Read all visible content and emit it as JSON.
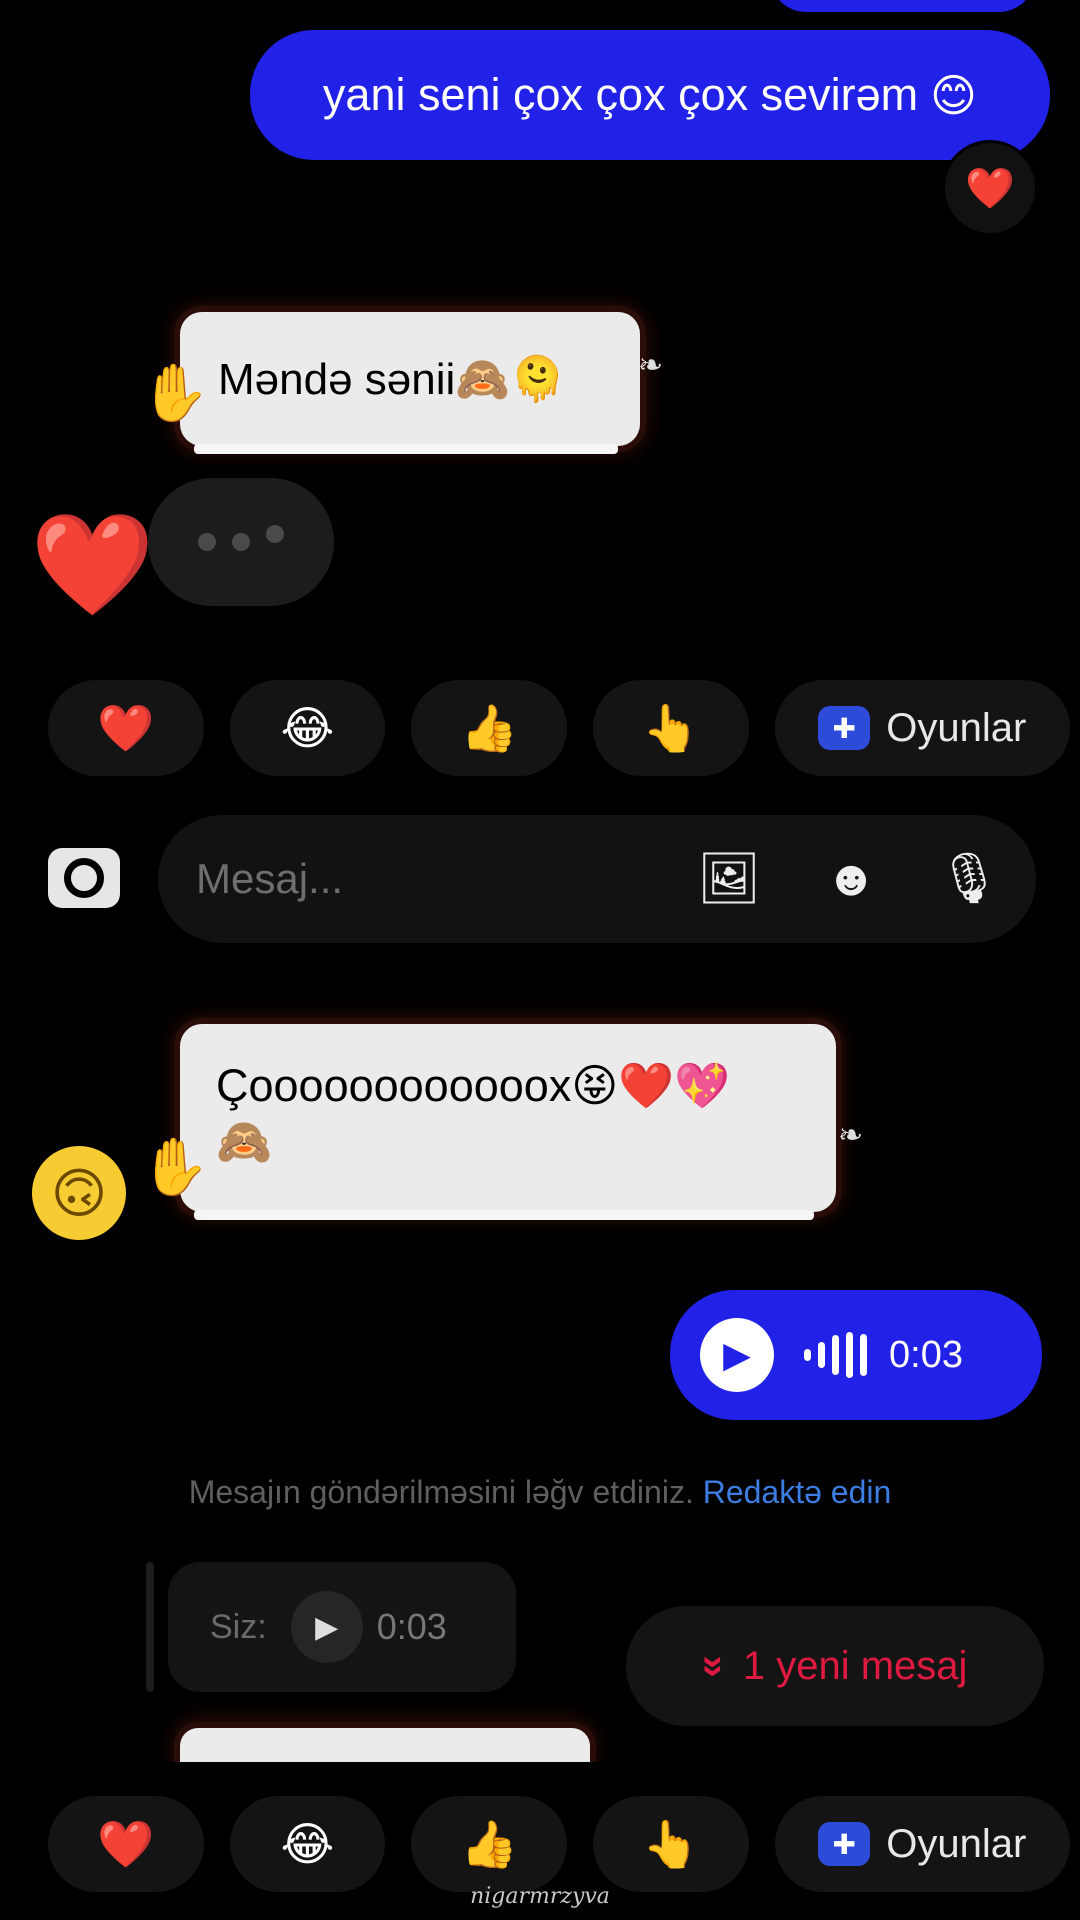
{
  "messages": {
    "sent_text": "yani seni çox çox çox sevirəm",
    "sent_text_emoji": "😊",
    "sent_reaction": "❤️",
    "sticker1_text": "Məndə sənii🙈🫠",
    "sticker2_text": "Çoooooooooooox😝❤️💖",
    "sticker2_line2": "🙈",
    "side_reaction_emoji": "🙃",
    "typing_reaction": "❤️",
    "voice_duration": "0:03"
  },
  "notice": {
    "text": "Mesajın göndərilməsini ləğv etdiniz.",
    "link": "Redaktə edin"
  },
  "quoted_reply": {
    "label": "Siz:",
    "duration": "0:03"
  },
  "new_message_pill": {
    "icon": "»",
    "label": "1 yeni mesaj"
  },
  "quick_replies": [
    {
      "emoji": "❤️"
    },
    {
      "emoji": "😂"
    },
    {
      "emoji": "👍"
    },
    {
      "emoji": "👆"
    },
    {
      "label": "Oyunlar",
      "icon": "gamepad-icon"
    }
  ],
  "compose": {
    "placeholder": "Mesaj..."
  },
  "watermark": "nigarmrzyva",
  "colors": {
    "sent_bubble": "#2121e8",
    "link": "#3b7de0",
    "new_message": "#e01940",
    "background": "#000000"
  }
}
